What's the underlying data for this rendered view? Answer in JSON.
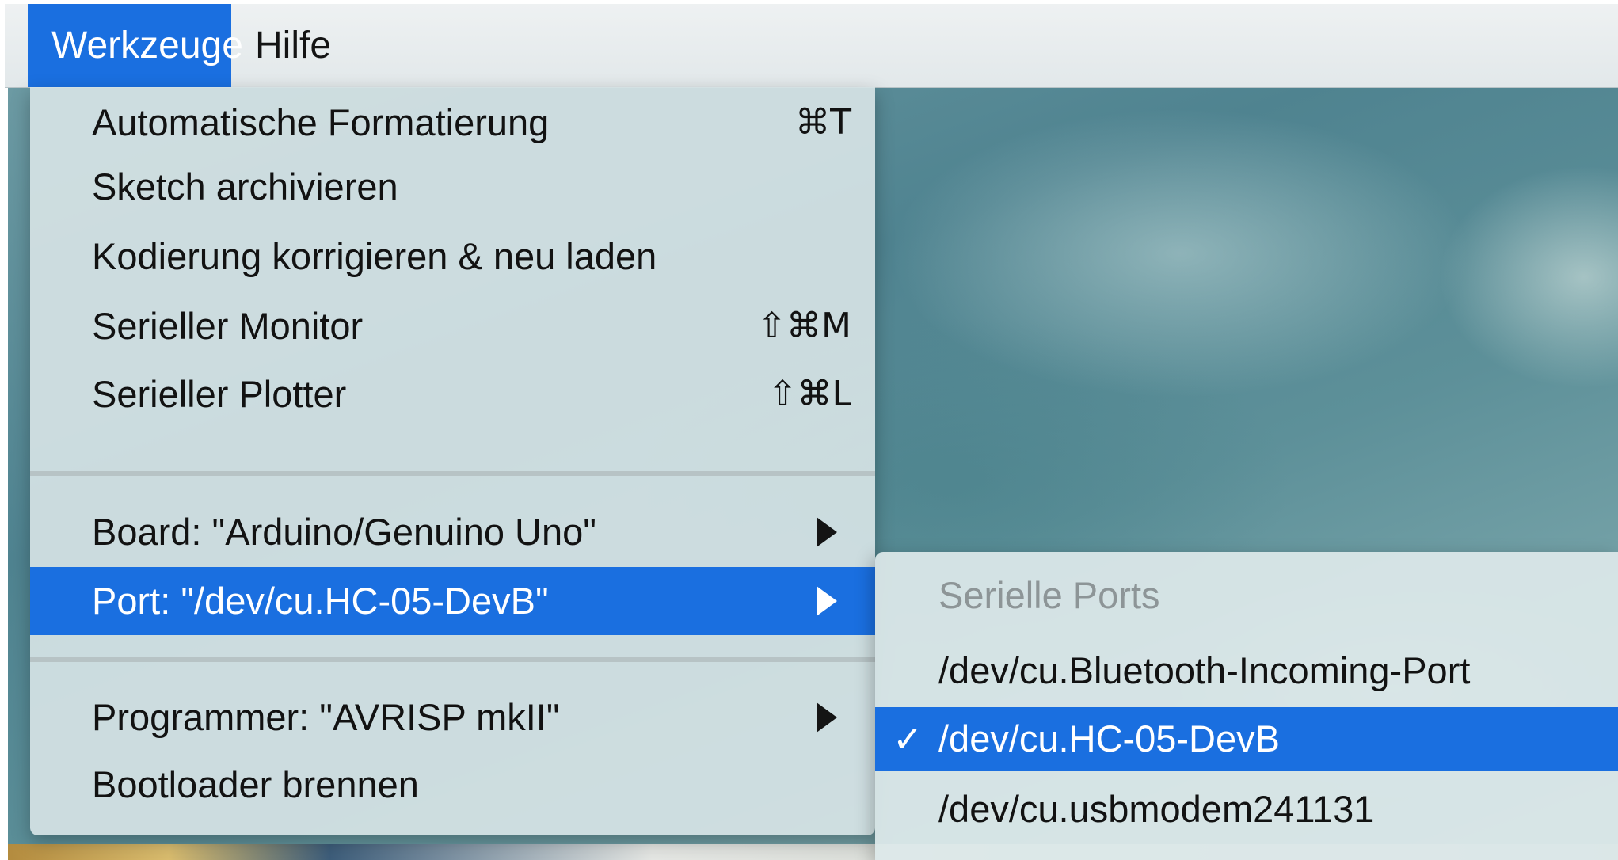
{
  "menubar": {
    "items": [
      {
        "label": "Werkzeuge",
        "active": true
      },
      {
        "label": "Hilfe",
        "active": false
      }
    ]
  },
  "tools_menu": {
    "items": [
      {
        "label": "Automatische Formatierung",
        "shortcut": "⌘T"
      },
      {
        "label": "Sketch archivieren",
        "shortcut": ""
      },
      {
        "label": "Kodierung korrigieren & neu laden",
        "shortcut": ""
      },
      {
        "label": "Serieller Monitor",
        "shortcut": "⇧⌘M"
      },
      {
        "label": "Serieller Plotter",
        "shortcut": "⇧⌘L"
      },
      {
        "label": "Board: \"Arduino/Genuino Uno\"",
        "submenu": true
      },
      {
        "label": "Port: \"/dev/cu.HC-05-DevB\"",
        "submenu": true,
        "selected": true
      },
      {
        "label": "Programmer: \"AVRISP mkII\"",
        "submenu": true
      },
      {
        "label": "Bootloader brennen",
        "shortcut": ""
      }
    ]
  },
  "port_submenu": {
    "header": "Serielle Ports",
    "check_mark": "✓",
    "items": [
      {
        "label": "/dev/cu.Bluetooth-Incoming-Port",
        "checked": false
      },
      {
        "label": "/dev/cu.HC-05-DevB",
        "checked": true
      },
      {
        "label": "/dev/cu.usbmodem241131",
        "checked": false
      }
    ]
  },
  "colors": {
    "selection": "#1a6fe0",
    "menu_background": "#d6e3e5",
    "disabled_text": "#8d9597"
  }
}
